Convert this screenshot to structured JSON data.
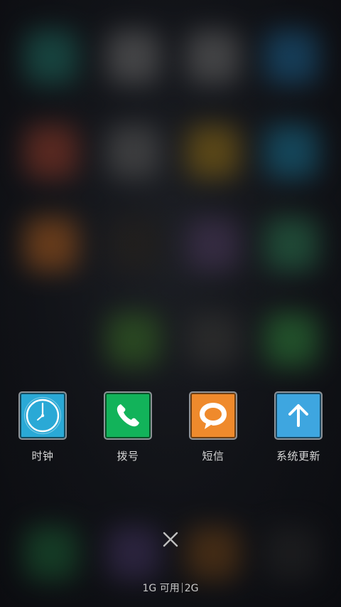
{
  "recent_apps": [
    {
      "label": "时钟",
      "icon": "clock-icon",
      "color": "#2aa9d6"
    },
    {
      "label": "拨号",
      "icon": "phone-icon",
      "color": "#12b35a"
    },
    {
      "label": "短信",
      "icon": "message-icon",
      "color": "#ef8a2c"
    },
    {
      "label": "系统更新",
      "icon": "arrow-up-icon",
      "color": "#3ea6e0"
    }
  ],
  "close_button": {
    "icon": "close-icon"
  },
  "memory": {
    "available": "1G 可用",
    "total": "2G"
  }
}
